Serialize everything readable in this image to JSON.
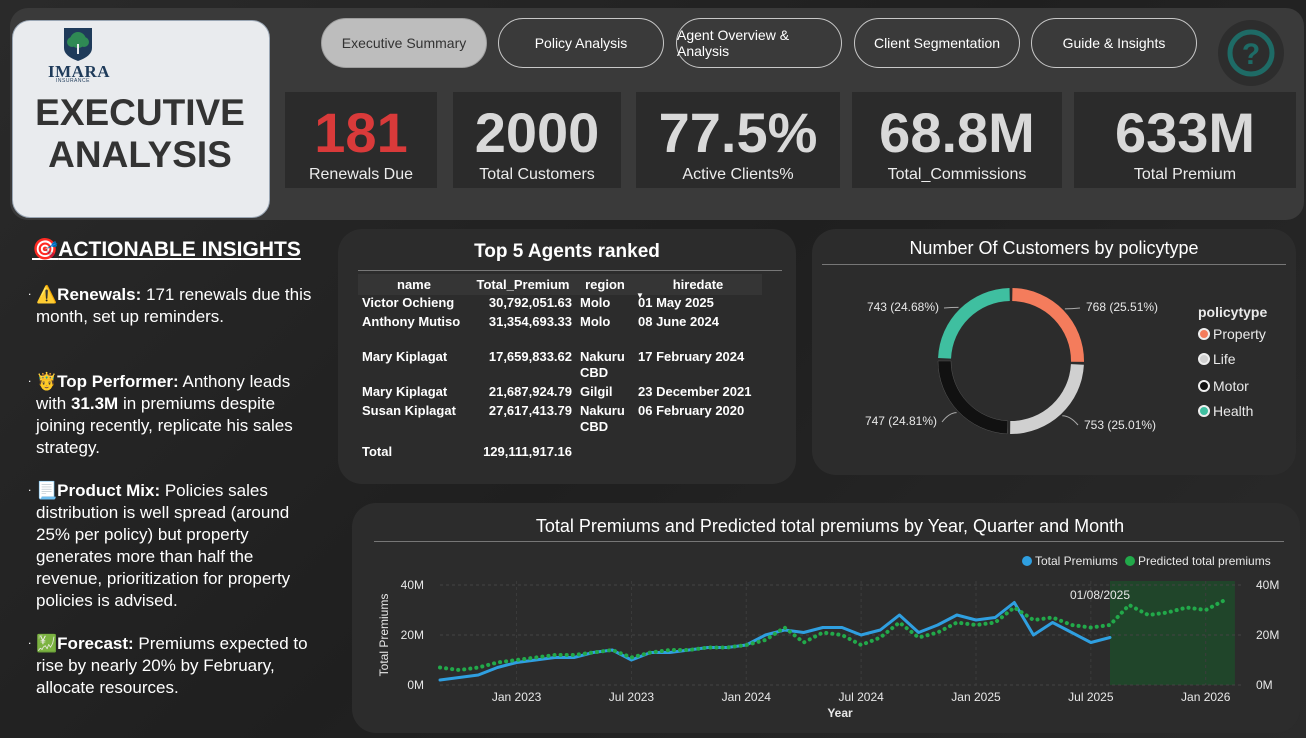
{
  "brand": {
    "name": "IMARA",
    "sub": "INSURANCE"
  },
  "page_title": {
    "line1": "EXECUTIVE",
    "line2": "ANALYSIS"
  },
  "nav": [
    {
      "label": "Executive Summary",
      "active": true
    },
    {
      "label": "Policy Analysis"
    },
    {
      "label": "Agent Overview & Analysis"
    },
    {
      "label": "Client Segmentation"
    },
    {
      "label": "Guide & Insights"
    }
  ],
  "help_icon": "question-icon",
  "kpis": [
    {
      "value": "181",
      "label": "Renewals Due",
      "color": "#d93a3a"
    },
    {
      "value": "2000",
      "label": "Total Customers"
    },
    {
      "value": "77.5%",
      "label": "Active Clients%"
    },
    {
      "value": "68.8M",
      "label": "Total_Commissions"
    },
    {
      "value": "633M",
      "label": "Total Premium"
    }
  ],
  "insights": {
    "title": "ACTIONABLE INSIGHTS",
    "items": [
      {
        "icon": "⚠️",
        "head": "Renewals:",
        "text": " 171 renewals due this month, set up reminders."
      },
      {
        "icon": "🤴",
        "head": "Top Performer:",
        "text_a": " Anthony leads with ",
        "bold": "31.3M",
        "text_b": " in premiums despite joining recently, replicate his sales strategy."
      },
      {
        "icon": "📃",
        "head": "Product Mix:",
        "text": " Policies sales distribution is well spread (around 25% per policy) but property generates more than half the revenue, prioritization for property policies is advised."
      },
      {
        "icon": "💹",
        "head": "Forecast:",
        "text": " Premiums expected to rise by nearly 20% by February, allocate resources."
      }
    ]
  },
  "agents_table": {
    "title": "Top 5 Agents ranked",
    "columns": [
      "name",
      "Total_Premium",
      "region",
      "hiredate"
    ],
    "rows": [
      [
        "Victor Ochieng",
        "30,792,051.63",
        "Molo",
        "01 May 2025"
      ],
      [
        "Anthony Mutiso",
        "31,354,693.33",
        "Molo",
        "08 June 2024"
      ],
      [
        "Mary Kiplagat",
        "17,659,833.62",
        "Nakuru CBD",
        "17 February 2024"
      ],
      [
        "Mary Kiplagat",
        "21,687,924.79",
        "Gilgil",
        "23 December 2021"
      ],
      [
        "Susan Kiplagat",
        "27,617,413.79",
        "Nakuru CBD",
        "06 February 2020"
      ]
    ],
    "total_label": "Total",
    "total_value": "129,111,917.16"
  },
  "pie_chart": {
    "title": "Number Of Customers by policytype",
    "legend_title": "policytype"
  },
  "line_chart": {
    "title": "Total Premiums and Predicted total premiums by Year, Quarter and Month",
    "annotation": "01/08/2025"
  },
  "chart_data": [
    {
      "type": "pie",
      "title": "Number Of Customers by policytype",
      "legend_title": "policytype",
      "legend_position": "right",
      "labels": [
        "Property",
        "Life",
        "Motor",
        "Health"
      ],
      "values": [
        768,
        753,
        747,
        743
      ],
      "data_labels": [
        "768 (25.51%)",
        "753 (25.01%)",
        "747 (24.81%)",
        "743 (24.68%)"
      ],
      "colors": [
        "#f47c5c",
        "#d0d0d0",
        "#111111",
        "#3fbfa0"
      ]
    },
    {
      "type": "line",
      "title": "Total Premiums and Predicted total premiums by Year, Quarter and Month",
      "xlabel": "Year",
      "ylabel": "Total Premiums",
      "ylim": [
        0,
        40
      ],
      "y_ticks": [
        "0M",
        "20M",
        "40M"
      ],
      "x_ticks": [
        "Jan 2023",
        "Jul 2023",
        "Jan 2024",
        "Jul 2024",
        "Jan 2025",
        "Jul 2025",
        "Jan 2026"
      ],
      "legend_position": "top-right",
      "grid": true,
      "series": [
        {
          "name": "Total Premiums",
          "color": "#2f9fe0",
          "style": "solid",
          "x": [
            "2022-09",
            "2022-10",
            "2022-11",
            "2022-12",
            "2023-01",
            "2023-02",
            "2023-03",
            "2023-04",
            "2023-05",
            "2023-06",
            "2023-07",
            "2023-08",
            "2023-09",
            "2023-10",
            "2023-11",
            "2023-12",
            "2024-01",
            "2024-02",
            "2024-03",
            "2024-04",
            "2024-05",
            "2024-06",
            "2024-07",
            "2024-08",
            "2024-09",
            "2024-10",
            "2024-11",
            "2024-12",
            "2025-01",
            "2025-02",
            "2025-03",
            "2025-04",
            "2025-05",
            "2025-06",
            "2025-07",
            "2025-08"
          ],
          "values": [
            2,
            3,
            4,
            7,
            9,
            10,
            11,
            11,
            13,
            14,
            10,
            13,
            13,
            14,
            15,
            15,
            16,
            20,
            22,
            21,
            23,
            23,
            20,
            22,
            28,
            21,
            24,
            28,
            26,
            27,
            33,
            20,
            25,
            21,
            17,
            19
          ]
        },
        {
          "name": "Predicted total premiums",
          "color": "#22a94a",
          "style": "dotted",
          "x": [
            "2022-09",
            "2022-10",
            "2022-11",
            "2022-12",
            "2023-01",
            "2023-02",
            "2023-03",
            "2023-04",
            "2023-05",
            "2023-06",
            "2023-07",
            "2023-08",
            "2023-09",
            "2023-10",
            "2023-11",
            "2023-12",
            "2024-01",
            "2024-02",
            "2024-03",
            "2024-04",
            "2024-05",
            "2024-06",
            "2024-07",
            "2024-08",
            "2024-09",
            "2024-10",
            "2024-11",
            "2024-12",
            "2025-01",
            "2025-02",
            "2025-03",
            "2025-04",
            "2025-05",
            "2025-06",
            "2025-07",
            "2025-08",
            "2025-09",
            "2025-10",
            "2025-11",
            "2025-12",
            "2026-01",
            "2026-02"
          ],
          "values": [
            7,
            6,
            7,
            9,
            10,
            11,
            12,
            12,
            13,
            14,
            11,
            13,
            14,
            14,
            15,
            15,
            16,
            18,
            23,
            17,
            21,
            20,
            16,
            19,
            25,
            19,
            21,
            25,
            24,
            25,
            31,
            26,
            27,
            24,
            23,
            24,
            32,
            28,
            29,
            31,
            30,
            34
          ]
        }
      ],
      "forecast_region": {
        "from": "2025-08",
        "to": "2026-02",
        "color": "#1e4a2a"
      }
    }
  ]
}
